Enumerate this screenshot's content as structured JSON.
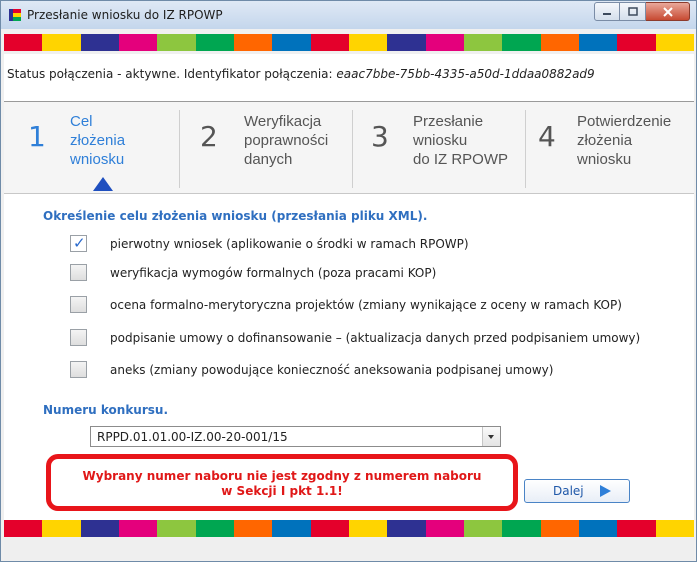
{
  "window": {
    "title": "Przesłanie wniosku do IZ RPOWP",
    "icon": "app-flag-icon",
    "controls": [
      "minimize-icon",
      "maximize-icon",
      "close-icon"
    ]
  },
  "palette": {
    "stripe": [
      "#e4002b",
      "#ffd400",
      "#2e3192",
      "#e4007c",
      "#8dc63f",
      "#00a651",
      "#ff6600",
      "#0072bc"
    ],
    "accent": "#2f7fd8",
    "error": "#e8151a"
  },
  "status": {
    "text": "Status połączenia - aktywne. Identyfikator połączenia: ",
    "connection_id": "eaac7bbe-75bb-4335-a50d-1ddaa0882ad9"
  },
  "steps": [
    {
      "number": "1",
      "label": "Cel\nzłożenia\nwniosku",
      "active": true
    },
    {
      "number": "2",
      "label": "Weryfikacja\npoprawności\ndanych",
      "active": false
    },
    {
      "number": "3",
      "label": "Przesłanie\nwniosku\ndo IZ RPOWP",
      "active": false
    },
    {
      "number": "4",
      "label": "Potwierdzenie\nzłożenia\nwniosku",
      "active": false
    }
  ],
  "purpose": {
    "heading": "Określenie celu złożenia wniosku (przesłania pliku XML).",
    "options": [
      {
        "label": "pierwotny wniosek (aplikowanie o środki w ramach RPOWP)",
        "checked": true
      },
      {
        "label": "weryfikacja wymogów formalnych (poza pracami KOP)",
        "checked": false
      },
      {
        "label": "ocena formalno-merytoryczna projektów (zmiany wynikające z oceny w ramach KOP)",
        "checked": false
      },
      {
        "label": "podpisanie umowy o dofinansowanie – (aktualizacja danych przed podpisaniem umowy)",
        "checked": false
      },
      {
        "label": "aneks (zmiany powodujące konieczność aneksowania podpisanej umowy)",
        "checked": false
      }
    ]
  },
  "contest": {
    "heading": "Numeru konkursu.",
    "selected": "RPPD.01.01.00-IZ.00-20-001/15"
  },
  "error_message": "Wybrany numer naboru nie jest zgodny z numerem naboru\nw Sekcji I pkt 1.1!",
  "next_button": {
    "label": "Dalej",
    "icon": "play-arrow-icon"
  }
}
